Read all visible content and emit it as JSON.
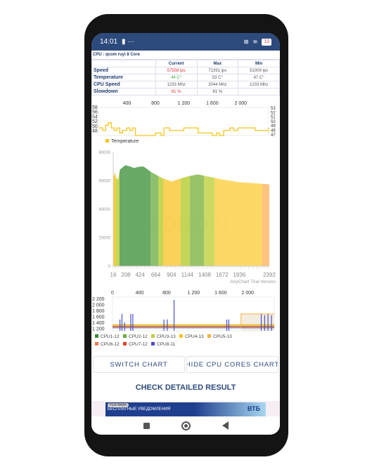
{
  "status_bar": {
    "time": "14:01",
    "battery": "13"
  },
  "cpu_title": "CPU : qcom ruyi 8 Core",
  "table": {
    "headers": [
      "",
      "Current",
      "Max",
      "Min"
    ],
    "rows": [
      {
        "label": "Speed",
        "current": "57558 ips",
        "max": "71391 ips",
        "min": "51009 ips"
      },
      {
        "label": "Temperature",
        "current": "44 C°",
        "max": "53 C°",
        "min": "47 C°"
      },
      {
        "label": "CPU Speed",
        "current": "1233 Mhz",
        "max": "2044 Mhz",
        "min": "1233 Mhz"
      },
      {
        "label": "Slowdown",
        "current": "81 %",
        "max": "81 %",
        "min": ""
      }
    ]
  },
  "chart_data": [
    {
      "type": "line",
      "series": [
        {
          "name": "Temperature",
          "color": "#f5c518",
          "x": [
            0,
            60,
            100,
            140,
            180,
            220,
            260,
            300,
            340,
            400,
            440,
            480,
            520,
            600,
            700,
            760,
            800,
            880,
            920,
            1000,
            1100,
            1200,
            1300,
            1380,
            1400,
            1500,
            1600,
            1640,
            1660,
            1700,
            1760,
            1800,
            1850,
            1900,
            1960,
            2000,
            2100,
            2200,
            2300,
            2392
          ],
          "values": [
            50,
            49,
            51,
            52,
            50,
            49,
            50,
            48,
            49,
            50,
            49,
            50,
            47,
            47,
            47,
            47,
            48,
            47,
            50,
            49,
            49,
            50,
            50,
            50,
            48,
            48,
            47,
            47,
            48,
            47,
            49,
            49,
            50,
            49,
            50,
            50,
            50,
            49,
            49,
            50
          ]
        }
      ],
      "x_ticks": [
        "400",
        "800",
        "1 200",
        "1 600",
        "2 000"
      ],
      "y_ticks": [
        "58",
        "56",
        "54",
        "52",
        "50",
        "48"
      ],
      "y2_ticks": [
        "53",
        "52",
        "51",
        "50",
        "49",
        "48",
        "47"
      ],
      "ylim": [
        47,
        58
      ],
      "xlim": [
        0,
        2392
      ],
      "legend": "bottom-left"
    },
    {
      "type": "area",
      "ylim": [
        0,
        80000
      ],
      "xlim": [
        16,
        2392
      ],
      "y_ticks": [
        "80000",
        "60000",
        "40000",
        "20000",
        "0"
      ],
      "x_ticks": [
        "16",
        "208",
        "424",
        "664",
        "904",
        "1144",
        "1408",
        "1672",
        "1936",
        "2392"
      ],
      "x": [
        16,
        40,
        60,
        90,
        120,
        200,
        280,
        330,
        420,
        480,
        600,
        760,
        904,
        1000,
        1144,
        1300,
        1408,
        1672,
        1936,
        2200,
        2392
      ],
      "values": [
        62000,
        66000,
        62000,
        61000,
        68000,
        71000,
        70000,
        69000,
        70000,
        70000,
        66000,
        62000,
        59500,
        61000,
        63000,
        64500,
        63500,
        61000,
        59000,
        58200,
        57500
      ],
      "bands": [
        {
          "from": 16,
          "to": 60,
          "color": "#f5c518"
        },
        {
          "from": 60,
          "to": 112,
          "color": "#b9cf3a"
        },
        {
          "from": 112,
          "to": 583,
          "color": "#4e9a4a"
        },
        {
          "from": 583,
          "to": 701,
          "color": "#79b555"
        },
        {
          "from": 701,
          "to": 776,
          "color": "#b9cf3a"
        },
        {
          "from": 776,
          "to": 1043,
          "color": "#f9c93c"
        },
        {
          "from": 1043,
          "to": 1183,
          "color": "#b9cf3a"
        },
        {
          "from": 1183,
          "to": 1397,
          "color": "#86b84e"
        },
        {
          "from": 1397,
          "to": 1557,
          "color": "#c4d24a"
        },
        {
          "from": 1557,
          "to": 2285,
          "color": "#fcd14c"
        },
        {
          "from": 2285,
          "to": 2392,
          "color": "#fdb86a"
        }
      ],
      "watermark": "3DROID",
      "credit": "AnyChart Trial Version"
    },
    {
      "type": "line",
      "xlim": [
        0,
        2392
      ],
      "ylim": [
        1100,
        2300
      ],
      "x_ticks": [
        "0",
        "400",
        "800",
        "1 200",
        "1 600",
        "2 000"
      ],
      "y_ticks": [
        "2 200",
        "2 000",
        "1 800",
        "1 600",
        "1 400",
        "1 200"
      ],
      "series": [
        {
          "name": "CPU1-12",
          "color": "#3a8a3a",
          "level": 1233
        },
        {
          "name": "CPU2-12",
          "color": "#6aab3a",
          "level": 1233
        },
        {
          "name": "CPU3-13",
          "color": "#c2cf3a",
          "level": 1280
        },
        {
          "name": "CPU4-13",
          "color": "#f5c518",
          "level": 1300
        },
        {
          "name": "CPU5-13",
          "color": "#fbb040",
          "level": 1320
        },
        {
          "name": "CPU6-12",
          "color": "#f07a4a",
          "level": 1260
        },
        {
          "name": "CPU7-12",
          "color": "#e84030",
          "level": 1240
        },
        {
          "name": "CPU8-11",
          "color": "#4a50c8",
          "level": 1200
        }
      ],
      "spikes": [
        {
          "x": 110,
          "v": 1500
        },
        {
          "x": 140,
          "v": 1700
        },
        {
          "x": 180,
          "v": 1400
        },
        {
          "x": 270,
          "v": 1700
        },
        {
          "x": 300,
          "v": 1700
        },
        {
          "x": 760,
          "v": 1500
        },
        {
          "x": 810,
          "v": 1500
        },
        {
          "x": 910,
          "v": 2200
        },
        {
          "x": 1690,
          "v": 1500
        },
        {
          "x": 1720,
          "v": 1500
        },
        {
          "x": 2200,
          "v": 1700
        },
        {
          "x": 2250,
          "v": 1650
        },
        {
          "x": 2300,
          "v": 1700
        },
        {
          "x": 2350,
          "v": 1650
        }
      ],
      "step": {
        "from": 1900,
        "to": 2392,
        "v": 1700
      }
    }
  ],
  "buttons": {
    "switch_chart": "SWITCH CHART",
    "hide_cores": "HIDE CPU CORES CHART",
    "check_result": "CHECK DETAILED RESULT"
  },
  "ad": {
    "tag": "РЕКЛАМА",
    "text": "БЕСПЛАТНЫЕ УВЕДОМЛЕНИЯ",
    "brand": "ВТБ"
  }
}
